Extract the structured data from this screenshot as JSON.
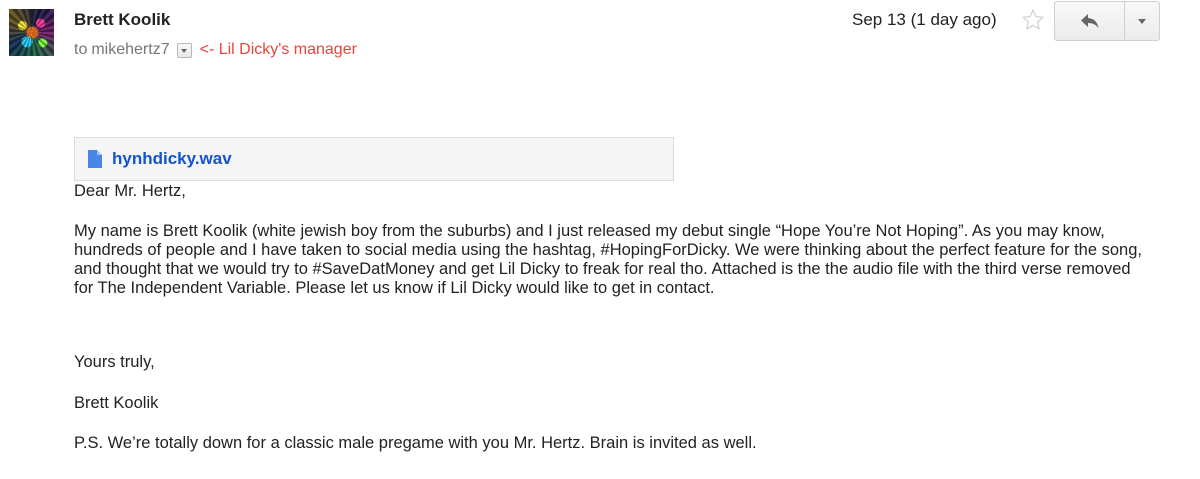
{
  "header": {
    "sender_name": "Brett Koolik",
    "to_prefix": "to",
    "recipient": "mikehertz7",
    "annotation": "<- Lil Dicky's manager",
    "date": "Sep 13 (1 day ago)"
  },
  "icons": {
    "avatar": "avatar",
    "details_toggle": "chevron-down-icon",
    "star": "star-icon",
    "reply": "reply-icon",
    "more": "dropdown-arrow-icon",
    "attachment": "file-icon"
  },
  "colors": {
    "link": "#1155cc",
    "annotation": "#e8453c",
    "text": "#222222",
    "muted": "#777777"
  },
  "attachment": {
    "filename": "hynhdicky.wav"
  },
  "body": {
    "greeting": "Dear Mr. Hertz,",
    "paragraph": "My name is Brett Koolik (white jewish boy from the suburbs) and I just released my debut single “Hope You’re Not Hoping”. As you may know, hundreds of people and I have taken to social media using the hashtag, #HopingForDicky. We were thinking about the perfect feature for the song, and thought that we would try to #SaveDatMoney and get Lil Dicky to freak for real tho. Attached is the the audio file with the third verse removed for The Independent Variable. Please let us know if Lil Dicky would like to get in contact.",
    "closing": "Yours truly,",
    "signature": "Brett Koolik",
    "ps": "P.S. We’re totally down for a classic male pregame with you Mr. Hertz. Brain is invited as well."
  }
}
